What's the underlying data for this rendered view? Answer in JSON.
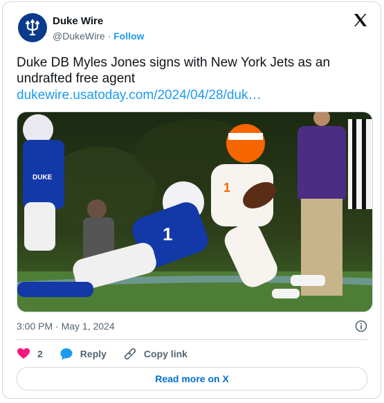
{
  "author": {
    "name": "Duke Wire",
    "handle": "@DukeWire",
    "separator": "·",
    "follow_label": "Follow"
  },
  "tweet": {
    "text": "Duke DB Myles Jones signs with New York Jets as an undrafted free agent",
    "link_text": "dukewire.usatoday.com/2024/04/28/duk…",
    "timestamp": "3:00 PM · May 1, 2024"
  },
  "actions": {
    "like_count": "2",
    "reply_label": "Reply",
    "copy_link_label": "Copy link"
  },
  "read_more_label": "Read more on X",
  "colors": {
    "accent": "#1d9bf0",
    "like": "#f91880",
    "duke_blue": "#0b3a8c",
    "clemson_orange": "#f56600"
  },
  "icons": [
    "duke-trident-icon",
    "x-logo-icon",
    "info-icon",
    "heart-icon",
    "reply-bubble-icon",
    "link-icon"
  ]
}
